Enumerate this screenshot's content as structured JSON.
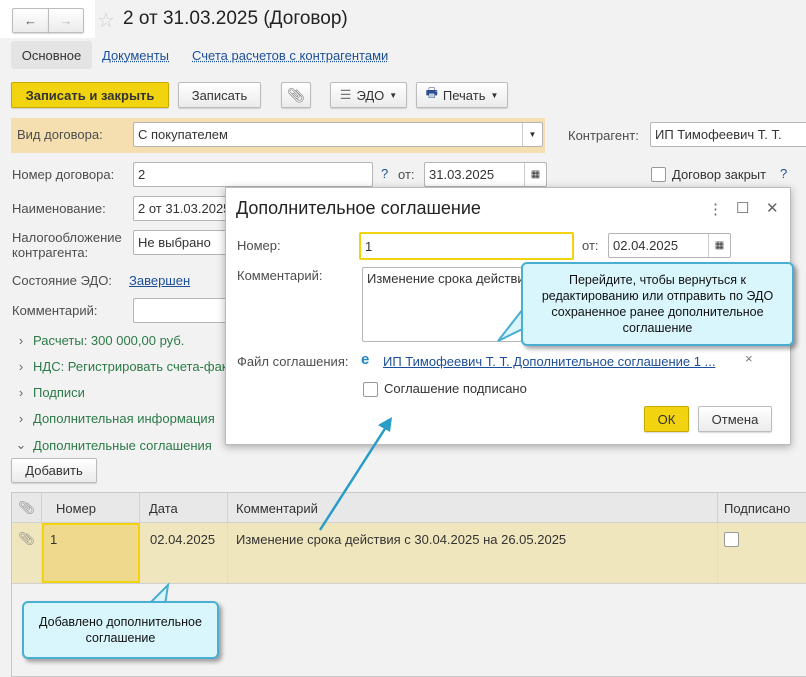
{
  "header": {
    "title": "2 от 31.03.2025 (Договор)",
    "back": "←",
    "forward": "→",
    "star": "☆"
  },
  "tabs": [
    {
      "label": "Основное"
    },
    {
      "label": "Документы"
    },
    {
      "label": "Счета расчетов с контрагентами"
    }
  ],
  "toolbar": {
    "save_close": "Записать и закрыть",
    "save": "Записать",
    "edo": "ЭДО",
    "print": "Печать"
  },
  "form": {
    "kind_label": "Вид договора:",
    "kind_value": "С покупателем",
    "counterparty_label": "Контрагент:",
    "counterparty_value": "ИП Тимофеевич Т. Т.",
    "number_label": "Номер договора:",
    "number_value": "2",
    "help": "?",
    "from_label": "от:",
    "date_value": "31.03.2025",
    "closed_label": "Договор закрыт",
    "name_label": "Наименование:",
    "name_value": "2 от 31.03.2025",
    "tax_label_1": "Налогообложение",
    "tax_label_2": "контрагента:",
    "tax_value": "Не выбрано",
    "edo_state_label": "Состояние ЭДО:",
    "edo_state_value": "Завершен",
    "comment_label": "Комментарий:",
    "comment_value": ""
  },
  "groups": [
    {
      "label": "Расчеты: 300 000,00 руб."
    },
    {
      "label": "НДС: Регистрировать счета-фактуры"
    },
    {
      "label": "Подписи"
    },
    {
      "label": "Дополнительная информация"
    },
    {
      "label": "Дополнительные соглашения"
    }
  ],
  "add_button": "Добавить",
  "table": {
    "columns": [
      "Номер",
      "Дата",
      "Комментарий",
      "Подписано"
    ],
    "rows": [
      {
        "number": "1",
        "date": "02.04.2025",
        "comment": "Изменение срока действия с 30.04.2025 на 26.05.2025",
        "signed": false
      }
    ]
  },
  "dialog": {
    "title": "Дополнительное соглашение",
    "number_label": "Номер:",
    "number_value": "1",
    "from_label": "от:",
    "date_value": "02.04.2025",
    "comment_label": "Комментарий:",
    "comment_value": "Изменение срока действия с 30.04.2025 на 26.05.2025",
    "file_label": "Файл соглашения:",
    "file_link": "ИП Тимофеевич Т. Т. Дополнительное соглашение 1 ...",
    "signed_label": "Соглашение подписано",
    "ok": "ОК",
    "cancel": "Отмена",
    "more": "⋮",
    "maximize": "☐",
    "close": "✕",
    "remove": "×"
  },
  "callouts": {
    "top": "Перейдите, чтобы вернуться к редактированию или отправить по ЭДО сохраненное ранее дополнительное соглашение",
    "bottom": "Добавлено дополнительное соглашение"
  },
  "colors": {
    "accent": "#f2d30f",
    "link": "#1c4f99",
    "group": "#2c7a48",
    "callout_bg": "#d9f6fc",
    "callout_border": "#4aaed0"
  }
}
